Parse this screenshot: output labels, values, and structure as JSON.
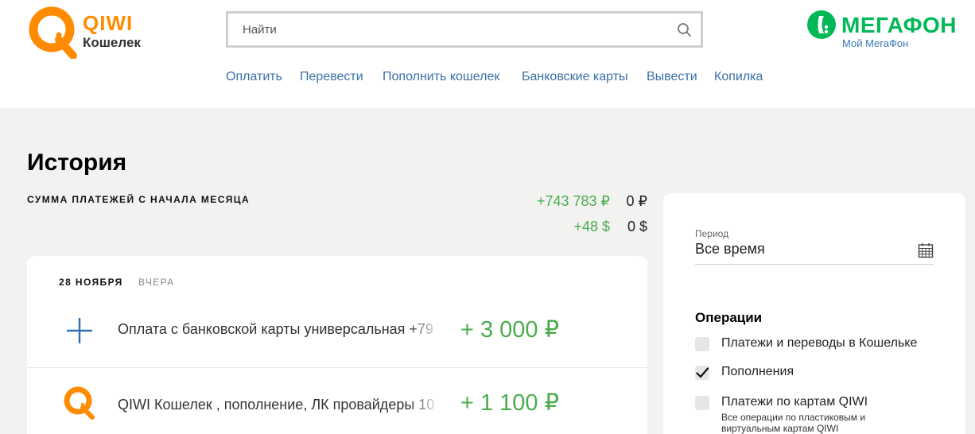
{
  "header": {
    "logo": {
      "title": "QIWI",
      "subtitle": "Кошелек"
    },
    "search": {
      "placeholder": "Найти"
    },
    "partner": {
      "title": "МЕГАФОН",
      "subtitle": "Мой МегаФон"
    },
    "nav": [
      {
        "label": "Оплатить"
      },
      {
        "label": "Перевести"
      },
      {
        "label": "Пополнить кошелек"
      },
      {
        "label": "Банковские карты"
      },
      {
        "label": "Вывести"
      },
      {
        "label": "Копилка"
      }
    ]
  },
  "page": {
    "title": "История",
    "summary": {
      "label": "СУММА ПЛАТЕЖЕЙ С НАЧАЛА МЕСЯЦА",
      "rub_in": "+743 783 ₽",
      "rub_out": "0 ₽",
      "usd_in": "+48 $",
      "usd_out": "0 $"
    }
  },
  "history": {
    "date": "28 НОЯБРЯ",
    "relative": "ВЧЕРА",
    "items": [
      {
        "icon": "plus-icon",
        "description": "Оплата с банковской карты универсальная +79",
        "amount": "+ 3 000 ₽"
      },
      {
        "icon": "qiwi-icon",
        "description": "QIWI Кошелек , пополнение, ЛК провайдеры 10",
        "amount": "+ 1 100 ₽"
      }
    ]
  },
  "filter": {
    "period_label": "Период",
    "period_value": "Все время",
    "operations_title": "Операции",
    "options": [
      {
        "label": "Платежи и переводы в Кошельке",
        "checked": false
      },
      {
        "label": "Пополнения",
        "checked": true
      },
      {
        "label": "Платежи по картам QIWI",
        "checked": false
      }
    ],
    "cards_note": "Все операции по пластиковым и виртуальным картам QIWI"
  },
  "colors": {
    "brand": "#ff8c00",
    "link": "#3a6fa8",
    "positive": "#4bac4e",
    "partner": "#00b956"
  }
}
